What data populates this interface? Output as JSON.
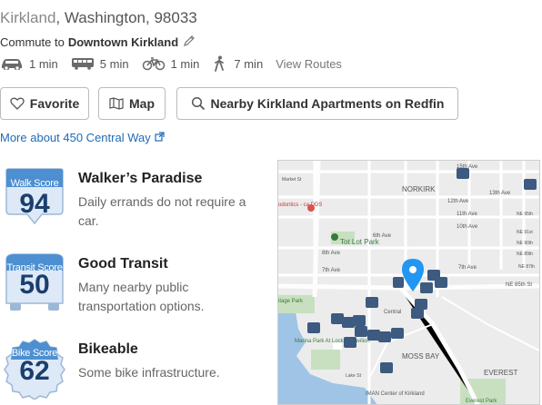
{
  "address": {
    "city": "Kirkland",
    "rest": ", Washington, 98033"
  },
  "commute": {
    "label": "Commute to",
    "destination": "Downtown Kirkland"
  },
  "modes": [
    {
      "name": "car",
      "time": "1 min"
    },
    {
      "name": "bus",
      "time": "5 min"
    },
    {
      "name": "bike",
      "time": "1 min"
    },
    {
      "name": "walk",
      "time": "7 min"
    }
  ],
  "view_routes": "View Routes",
  "buttons": {
    "favorite": "Favorite",
    "map": "Map",
    "nearby": "Nearby Kirkland Apartments on Redfin"
  },
  "more_link": "More about 450 Central Way",
  "scores": {
    "walk": {
      "badge_label": "Walk Score",
      "value": "94",
      "heading": "Walker’s Paradise",
      "description": "Daily errands do not require a car."
    },
    "transit": {
      "badge_label": "Transit Score",
      "value": "50",
      "heading": "Good Transit",
      "description": "Many nearby public transportation options."
    },
    "bike": {
      "badge_label": "Bike Score",
      "value": "62",
      "heading": "Bikeable",
      "description": "Some bike infrastructure."
    }
  },
  "map": {
    "labels": {
      "street_15th": "15th Ave",
      "street_13th": "13th Ave",
      "street_12th": "12th Ave",
      "street_11th": "11th Ave",
      "street_10th": "10th Ave",
      "street_8th": "8th Ave",
      "street_7th": "7th Ave",
      "street_7th_b": "7th Ave",
      "street_6th": "6th Ave",
      "market_st": "Market St",
      "norkirk": "NORKIRK",
      "tot_lot": "Tot Lot Park",
      "dental": "odontics - ca DDS",
      "ne85": "NE 85th St",
      "ne_e": "NE 87th",
      "moss_bay": "MOSS BAY",
      "everest": "EVEREST",
      "everest_park": "Everest Park",
      "marina": "Marina Park At Lockes Pavilion",
      "heritage": "itage Park",
      "central": "Central",
      "kirkland_center": "IMAN Center of Kirkland",
      "lake": "Lake St",
      "ne_95": "NE 95th",
      "ne_91": "NE 91st",
      "ne_90": "NE 90th",
      "ne_89": "NE 89th"
    },
    "colors": {
      "land": "#ececec",
      "water": "#9fc4e6",
      "park": "#c8e0c0",
      "pin": "#2196f3",
      "marker": "#3d5a80"
    }
  }
}
